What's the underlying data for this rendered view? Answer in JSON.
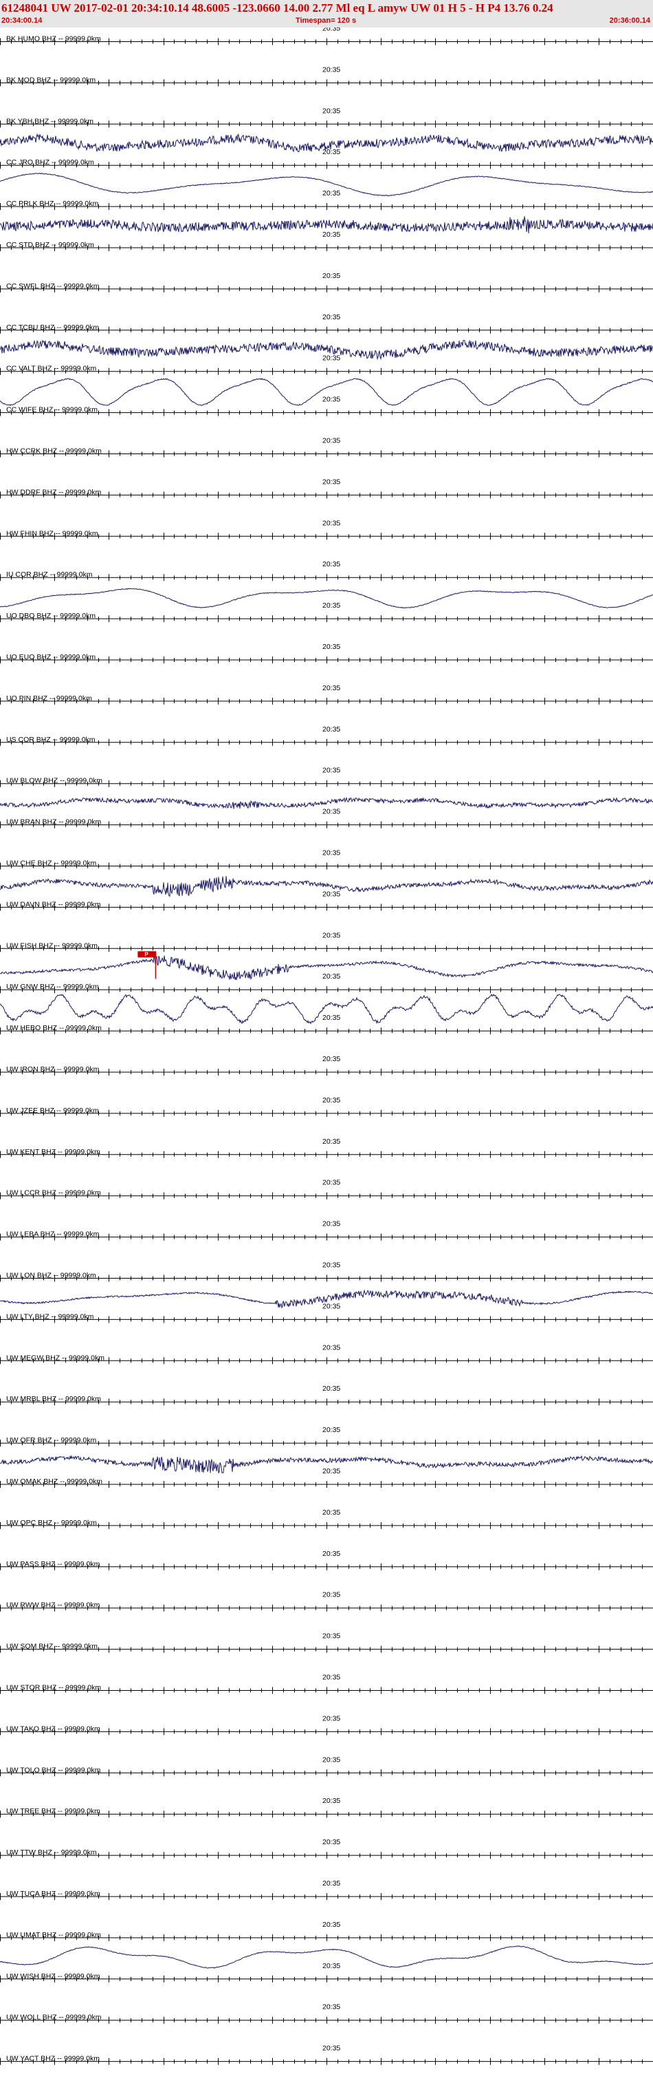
{
  "header": {
    "title": "61248041 UW 2017-02-01 20:34:10.14   48.6005 -123.0660  14.00  2.77 Ml  eq  L amyw    UW 01  H   5  -  H P4   13.76  0.24",
    "start_time": "20:34:00.14",
    "timespan": "Timespan= 120 s",
    "end_time": "20:36:00.14"
  },
  "colors": {
    "header_bg": "#e6e6e6",
    "header_text": "#cc0000",
    "trace": "#1a1a66",
    "axis": "#000000",
    "pick": "#cc0000"
  },
  "chart_data": {
    "type": "line",
    "title": "",
    "x_unit": "s",
    "x_range": [
      0,
      120
    ],
    "minute_marker_label": "20:35",
    "minute_marker_x": 60,
    "channels": [
      {
        "label": "BK HUMO BHZ -- 99999.0km",
        "trace": "none"
      },
      {
        "label": "BK MOD BHZ -- 99999.0km",
        "trace": "none"
      },
      {
        "label": "BK YBH BHZ -- 99999.0km",
        "trace": "noisy"
      },
      {
        "label": "CC JRO BHZ -- 99999.0km",
        "trace": "slow"
      },
      {
        "label": "CC PRLK BHZ -- 99999.0km",
        "trace": "noisy-dense"
      },
      {
        "label": "CC STD BHZ -- 99999.0km",
        "trace": "none"
      },
      {
        "label": "CC SWFL BHZ -- 99999.0km",
        "trace": "none"
      },
      {
        "label": "CC TCBU BHZ -- 99999.0km",
        "trace": "noisy"
      },
      {
        "label": "CC VALT BHZ -- 99999.0km",
        "trace": "slow-large"
      },
      {
        "label": "CC WIFE BHZ -- 99999.0km",
        "trace": "none"
      },
      {
        "label": "HW CCRK BHZ -- 99999.0km",
        "trace": "none"
      },
      {
        "label": "HW DDRF BHZ -- 99999.0km",
        "trace": "none"
      },
      {
        "label": "HW FHIN BHZ -- 99999.0km",
        "trace": "none"
      },
      {
        "label": "IU COR BHZ -- 99999.0km",
        "trace": "slow"
      },
      {
        "label": "UO DBO BHZ -- 99999.0km",
        "trace": "none"
      },
      {
        "label": "UO EUO BHZ -- 99999.0km",
        "trace": "none"
      },
      {
        "label": "UO PIN BHZ -- 99999.0km",
        "trace": "none"
      },
      {
        "label": "US COR BHZ -- 99999.0km",
        "trace": "none"
      },
      {
        "label": "UW BLOW BHZ -- 99999.0km",
        "trace": "mixed"
      },
      {
        "label": "UW BRAN BHZ -- 99999.0km",
        "trace": "none"
      },
      {
        "label": "UW CHE BHZ -- 99999.0km",
        "trace": "event"
      },
      {
        "label": "UW DAVN BHZ -- 99999.0km",
        "trace": "none"
      },
      {
        "label": "UW FISH BHZ -- 99999.0km",
        "trace": "event-pick"
      },
      {
        "label": "UW GNW BHZ -- 99999.0km",
        "trace": "mixed-large"
      },
      {
        "label": "UW HEBO BHZ -- 99999.0km",
        "trace": "none"
      },
      {
        "label": "UW IRON BHZ -- 99999.0km",
        "trace": "none"
      },
      {
        "label": "UW JZEE BHZ -- 99999.0km",
        "trace": "none"
      },
      {
        "label": "UW KENT BHZ -- 99999.0km",
        "trace": "none"
      },
      {
        "label": "UW LCCR BHZ -- 99999.0km",
        "trace": "none"
      },
      {
        "label": "UW LEBA BHZ -- 99999.0km",
        "trace": "none"
      },
      {
        "label": "UW LON BHZ -- 99999.0km",
        "trace": "event-late"
      },
      {
        "label": "UW LTY BHZ -- 99999.0km",
        "trace": "none"
      },
      {
        "label": "UW MEGW BHZ -- 99999.0km",
        "trace": "none"
      },
      {
        "label": "UW MRBL BHZ -- 99999.0km",
        "trace": "none"
      },
      {
        "label": "UW OFR BHZ -- 99999.0km",
        "trace": "event"
      },
      {
        "label": "UW OMAK BHZ -- 99999.0km",
        "trace": "none"
      },
      {
        "label": "UW OPC BHZ -- 99999.0km",
        "trace": "none"
      },
      {
        "label": "UW PASS BHZ -- 99999.0km",
        "trace": "none"
      },
      {
        "label": "UW RWW BHZ -- 99999.0km",
        "trace": "none"
      },
      {
        "label": "UW SQM BHZ -- 99999.0km",
        "trace": "none"
      },
      {
        "label": "UW STOR BHZ -- 99999.0km",
        "trace": "none"
      },
      {
        "label": "UW TAKO BHZ -- 99999.0km",
        "trace": "none"
      },
      {
        "label": "UW TOLO BHZ -- 99999.0km",
        "trace": "none"
      },
      {
        "label": "UW TREE BHZ -- 99999.0km",
        "trace": "none"
      },
      {
        "label": "UW TTW BHZ -- 99999.0km",
        "trace": "none"
      },
      {
        "label": "UW TUCA BHZ -- 99999.0km",
        "trace": "none"
      },
      {
        "label": "UW UMAT BHZ -- 99999.0km",
        "trace": "slow"
      },
      {
        "label": "UW WISH BHZ -- 99999.0km",
        "trace": "none"
      },
      {
        "label": "UW WOLL BHZ -- 99999.0km",
        "trace": "none"
      },
      {
        "label": "UW YACT BHZ -- 99999.0km",
        "trace": "none"
      }
    ],
    "pick": {
      "channel": "UW FISH BHZ -- 99999.0km",
      "time_s": 28.6,
      "label": "P"
    }
  }
}
